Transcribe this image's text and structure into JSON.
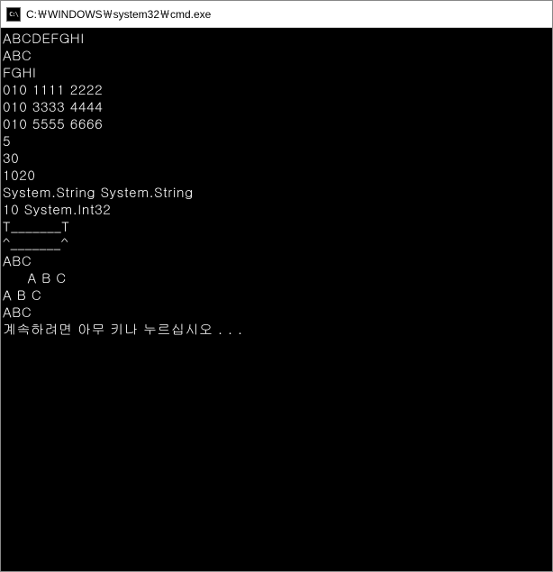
{
  "window": {
    "title": "C:￦WINDOWS￦system32￦cmd.exe",
    "icon_label": "C:\\"
  },
  "console": {
    "lines": [
      "ABCDEFGHI",
      "ABC",
      "FGHI",
      "010 1111 2222",
      "010 3333 4444",
      "010 5555 6666",
      "5",
      "30",
      "1020",
      "System.String System.String",
      "10 System.Int32",
      "T_______T",
      "^_______^",
      "ABC",
      "     A B C",
      "A B C",
      "ABC",
      "계속하려면 아무 키나 누르십시오 . . ."
    ]
  }
}
